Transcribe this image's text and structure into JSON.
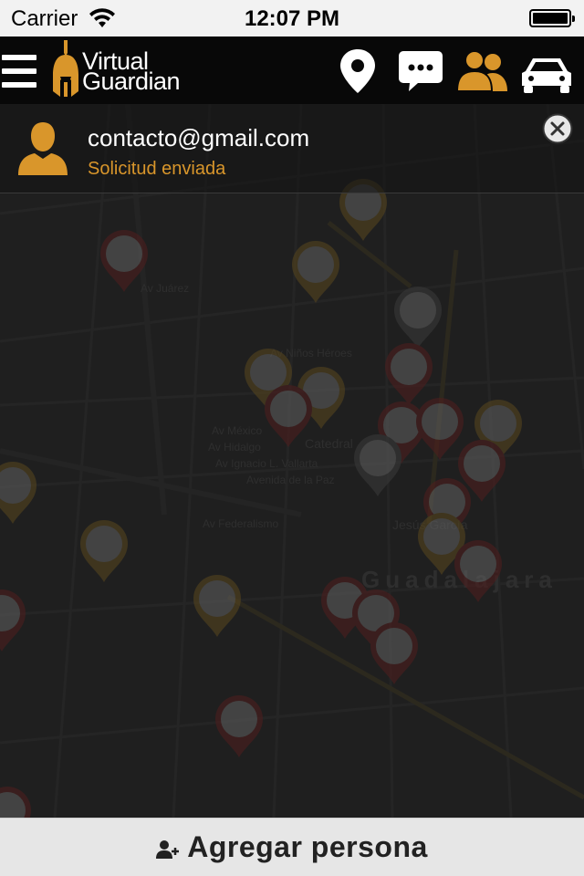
{
  "status_bar": {
    "carrier": "Carrier",
    "time": "12:07 PM"
  },
  "nav_bar": {
    "logo_line1": "Virtual",
    "logo_line2": "Guardian",
    "icons": [
      "menu-icon",
      "location-pin-icon",
      "chat-icon",
      "contacts-icon",
      "car-icon"
    ],
    "active_icon": "contacts-icon",
    "accent_color": "#d9962b"
  },
  "contact": {
    "email": "contacto@gmail.com",
    "status": "Solicitud enviada"
  },
  "map": {
    "labels": {
      "city": "Guadalajara",
      "catedral": "Catedral",
      "jesus_garcia": "Jesús García",
      "av_mexico": "Av México",
      "av_hidalgo": "Av Hidalgo",
      "av_vallarta": "Av Ignacio L. Vallarta",
      "av_paz": "Avenida de la Paz",
      "av_federalismo": "Av Federalismo",
      "av_niños_heroes": "Av Niños Héroes",
      "av_juarez": "Av Juárez"
    }
  },
  "bottom_bar": {
    "add_label": "Agregar persona"
  }
}
